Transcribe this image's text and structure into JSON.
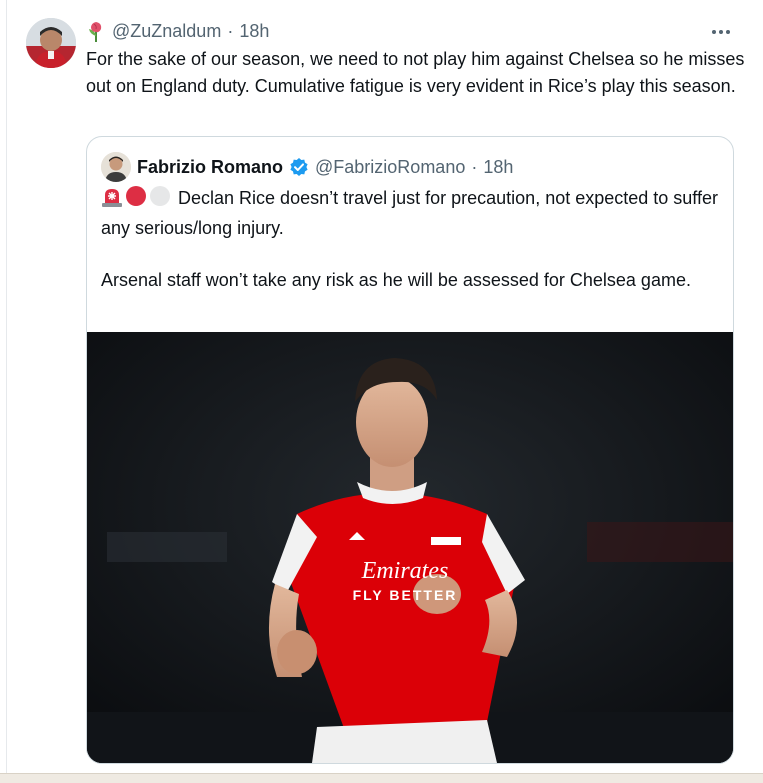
{
  "post": {
    "handle": "@ZuZnaldum",
    "separator": "·",
    "time": "18h",
    "text": "For the sake of our season, we need to not play him against Chelsea so he misses out on England duty. Cumulative fatigue is very evident in Rice’s play this season."
  },
  "quote": {
    "name": "Fabrizio Romano",
    "handle": "@FabrizioRomano",
    "separator": "·",
    "time": "18h",
    "paragraph1": "Declan Rice doesn’t travel just for precaution, not expected to suffer any serious/long injury.",
    "paragraph2": "Arsenal staff won’t take any risk as he will be assessed for Chelsea game.",
    "media": {
      "shirt_sponsor_line1": "Emirates",
      "shirt_sponsor_line2": "FLY BETTER"
    }
  },
  "colors": {
    "text_primary": "#0f1419",
    "text_secondary": "#536471",
    "verified": "#1d9bf0",
    "card_border": "#cfd9de"
  },
  "icons": {
    "handle_emoji": "rose-icon",
    "verified": "verified-badge-icon",
    "more": "more-options-icon",
    "quote_emojis": [
      "siren-icon",
      "red-circle-icon",
      "white-circle-icon"
    ]
  }
}
